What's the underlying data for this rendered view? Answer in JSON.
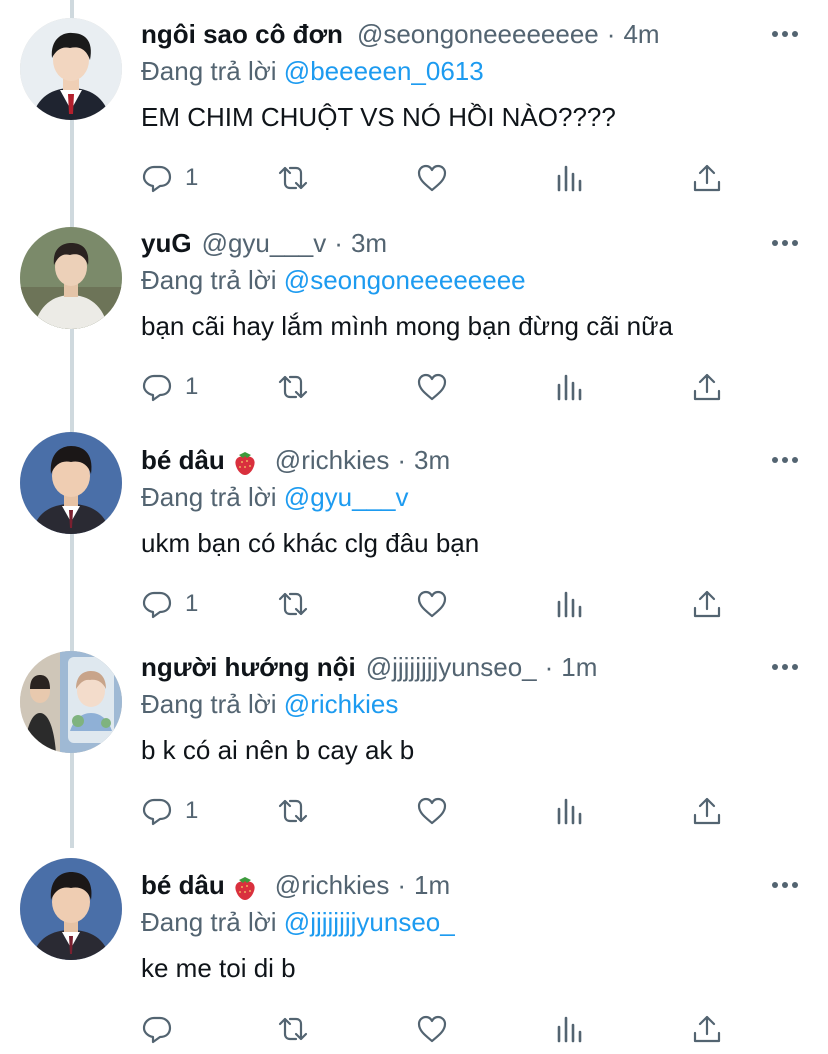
{
  "reply_prefix": "Đang trả lời",
  "colors": {
    "link": "#1d9bf0",
    "secondary": "#536471",
    "text": "#0f1419",
    "thread_line": "#cfd9de"
  },
  "icons": [
    "reply-icon",
    "retweet-icon",
    "like-icon",
    "views-icon",
    "share-icon",
    "more-icon",
    "strawberry-icon"
  ],
  "tweets": [
    {
      "name": "ngôi sao cô đơn",
      "handle": "@seongoneeeeeeee",
      "time": "4m",
      "reply_to": "@beeeeen_0613",
      "text": "EM CHIM CHUỘT VS NÓ HỒI NÀO????",
      "reply_count": "1"
    },
    {
      "name": "yuG",
      "handle": "@gyu___v",
      "time": "3m",
      "reply_to": "@seongoneeeeeeee",
      "text": "bạn cãi hay lắm mình mong bạn đừng cãi nữa",
      "reply_count": "1"
    },
    {
      "name": "bé dâu",
      "handle": "@richkies",
      "time": "3m",
      "reply_to": "@gyu___v",
      "text": "ukm bạn có khác clg đâu bạn",
      "reply_count": "1"
    },
    {
      "name": "người hướng nội",
      "handle": "@jjjjjjjjyunseo_",
      "time": "1m",
      "reply_to": "@richkies",
      "text": "b k có ai nên b cay ak b",
      "reply_count": "1"
    },
    {
      "name": "bé dâu",
      "handle": "@richkies",
      "time": "1m",
      "reply_to": "@jjjjjjjjyunseo_",
      "text": "ke me toi di b",
      "reply_count": ""
    }
  ]
}
